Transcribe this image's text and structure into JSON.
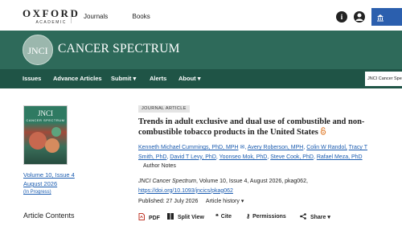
{
  "topbar": {
    "logo_main": "OXFORD",
    "logo_sub": "ACADEMIC",
    "nav": [
      "Journals",
      "Books"
    ],
    "info_icon": "i",
    "user_icon": "user",
    "bank_icon": "bank-icon"
  },
  "journal": {
    "badge": "JNCI",
    "title": "CANCER SPECTRUM"
  },
  "navbar": {
    "items": [
      "Issues",
      "Advance Articles",
      "Submit ▾",
      "Alerts",
      "About ▾"
    ],
    "search_scope": "JNCI Cancer Spectrum"
  },
  "sidebar": {
    "cover_title": "JNCI",
    "cover_sub": "CANCER SPECTRUM",
    "issue_line1": "Volume 10, Issue 4",
    "issue_line2": "August 2026",
    "status": "(In Progress)",
    "contents_heading": "Article Contents"
  },
  "article": {
    "type_badge": "JOURNAL ARTICLE",
    "title": "Trends in adult exclusive and dual use of combustible and non-combustible tobacco products in the United States",
    "authors": [
      "Kenneth Michael Cummings, PhD, MPH",
      "Avery Roberson, MPH",
      "Colin W Randol,",
      "Tracy T Smith, PhD",
      "David T Levy, PhD",
      "Yoonseo Mok, PhD",
      "Steve Cook, PhD",
      "Rafael Meza, PhD"
    ],
    "author_notes": "Author Notes",
    "journal_name": "JNCI Cancer Spectrum",
    "citation_rest": ", Volume 10, Issue 4, August 2026, pkag062,",
    "doi": "https://doi.org/10.1093/jncics/pkag062",
    "published_label": "Published:",
    "published_date": "27 July 2026",
    "history": "Article history ▾"
  },
  "toolbar": {
    "pdf": "PDF",
    "split_view": "Split View",
    "cite": "Cite",
    "permissions": "Permissions",
    "share": "Share ▾"
  },
  "colors": {
    "header_green": "#2e6a5a",
    "nav_green": "#1f5446",
    "link_blue": "#1b5cb0",
    "open_access_orange": "#e07b2a"
  }
}
